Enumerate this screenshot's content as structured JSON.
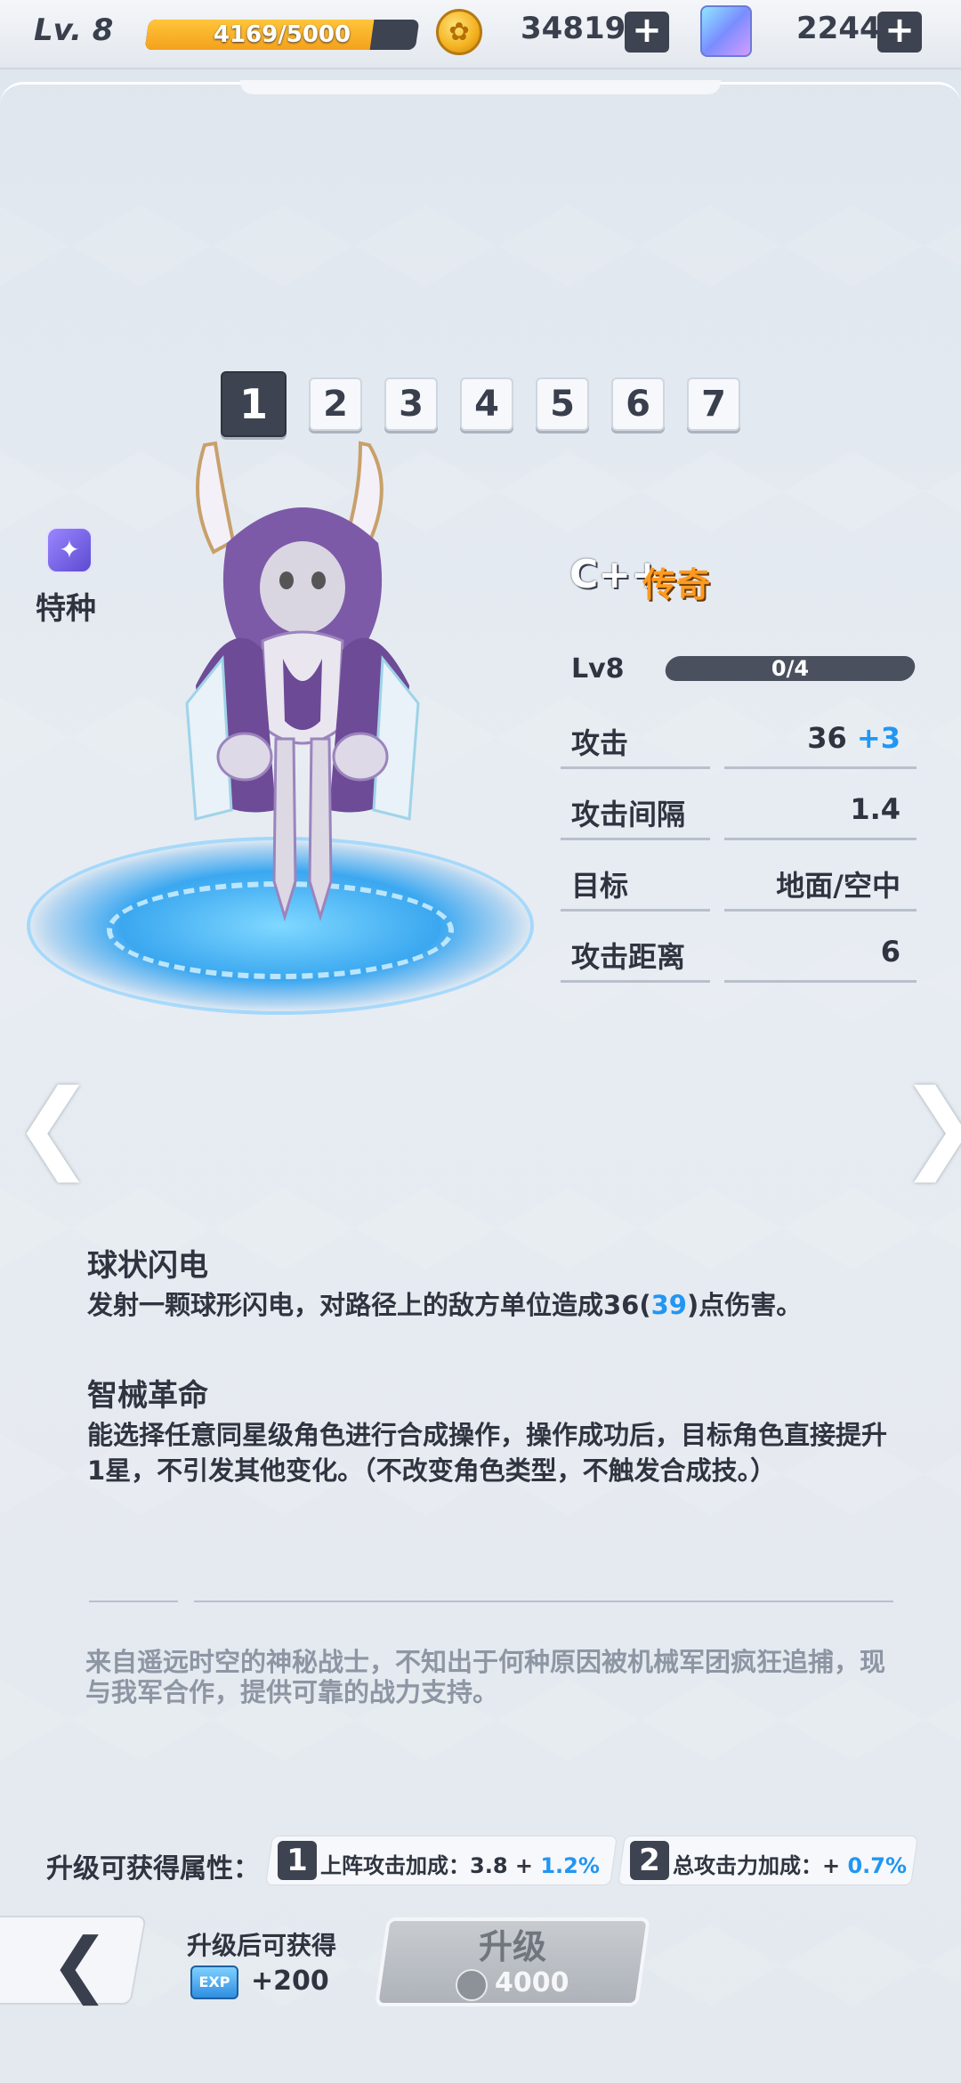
{
  "header": {
    "level_label": "Lv. 8",
    "xp_text": "4169/5000",
    "xp_progress": 0.8338,
    "coins": "34819",
    "gems": "2244",
    "plus": "+"
  },
  "star_tabs": [
    "1",
    "2",
    "3",
    "4",
    "5",
    "6",
    "7"
  ],
  "active_star": "1",
  "hero": {
    "class_label": "特种",
    "name": "C++",
    "rarity": "传奇",
    "level": "Lv8",
    "card_progress": "0/4"
  },
  "stats": [
    {
      "label": "攻击",
      "value": "36",
      "bonus": "+3"
    },
    {
      "label": "攻击间隔",
      "value": "1.4",
      "bonus": ""
    },
    {
      "label": "目标",
      "value": "地面/空中",
      "bonus": ""
    },
    {
      "label": "攻击距离",
      "value": "6",
      "bonus": ""
    }
  ],
  "nav": {
    "prev": "❮",
    "next": "❯"
  },
  "skills": [
    {
      "title": "球状闪电",
      "desc_pre": "发射一颗球形闪电，对路径上的敌方单位造成36(",
      "desc_bonus": "39",
      "desc_post": ")点伤害。"
    },
    {
      "title": "智械革命",
      "desc": "能选择任意同星级角色进行合成操作，操作成功后，目标角色直接提升1星，不引发其他变化。（不改变角色类型，不触发合成技。）"
    }
  ],
  "lore": "来自遥远时空的神秘战士，不知出于何种原因被机械军团疯狂追捕，现与我军合作，提供可靠的战力支持。",
  "upgrade_attrs": {
    "title": "升级可获得属性：",
    "items": [
      {
        "num": "1",
        "text": "上阵攻击加成：3.8 + ",
        "bonus": "1.2%"
      },
      {
        "num": "2",
        "text": "总攻击力加成：+ ",
        "bonus": "0.7%"
      }
    ]
  },
  "bottom": {
    "back": "❮",
    "gain_title": "升级后可获得",
    "exp_label": "EXP",
    "exp_value": "+200",
    "upgrade_label": "升级",
    "upgrade_cost": "4000"
  }
}
